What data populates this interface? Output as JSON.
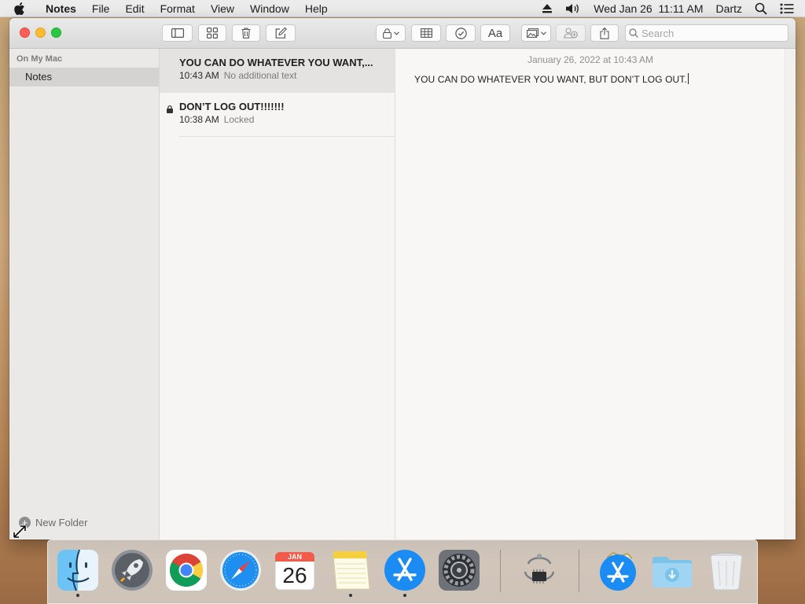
{
  "menubar": {
    "app_name": "Notes",
    "menus": [
      "File",
      "Edit",
      "Format",
      "View",
      "Window",
      "Help"
    ],
    "datetime": "Wed Jan 26  11:11 AM",
    "user": "Dartz",
    "icons": [
      "apple-icon",
      "eject-icon",
      "volume-icon",
      "spotlight-search-icon",
      "notification-center-icon"
    ]
  },
  "toolbar": {
    "search_placeholder": "Search",
    "buttons": [
      "sidebar-toggle",
      "gallery-view",
      "delete",
      "compose",
      "lock",
      "table",
      "checklist",
      "format",
      "media",
      "collaborate",
      "share"
    ],
    "format_label": "Aa"
  },
  "sidebar": {
    "section": "On My Mac",
    "folders": [
      {
        "label": "Notes",
        "selected": true
      }
    ],
    "new_folder": "New Folder"
  },
  "notes": [
    {
      "title": "YOU CAN DO WHATEVER YOU WANT,...",
      "time": "10:43 AM",
      "subtitle": "No additional text",
      "selected": true,
      "locked": false
    },
    {
      "title": "DON’T LOG OUT!!!!!!!",
      "time": "10:38 AM",
      "subtitle": "Locked",
      "selected": false,
      "locked": true
    }
  ],
  "editor": {
    "date": "January 26, 2022 at 10:43 AM",
    "body": "YOU CAN DO WHATEVER YOU WANT, BUT DON’T LOG OUT."
  },
  "dock": {
    "calendar_month": "JAN",
    "calendar_day": "26",
    "apps": [
      "Finder",
      "Launchpad",
      "Google Chrome",
      "Safari",
      "Calendar",
      "Notes",
      "App Store",
      "System Preferences",
      "System Information",
      "App Store Installer",
      "Downloads",
      "Trash"
    ]
  },
  "colors": {
    "close": "#ff5f57",
    "minimize": "#febc2e",
    "maximize": "#28c840",
    "selected_row": "#e4e3e1",
    "sidebar_selected": "#d4d3d1"
  }
}
